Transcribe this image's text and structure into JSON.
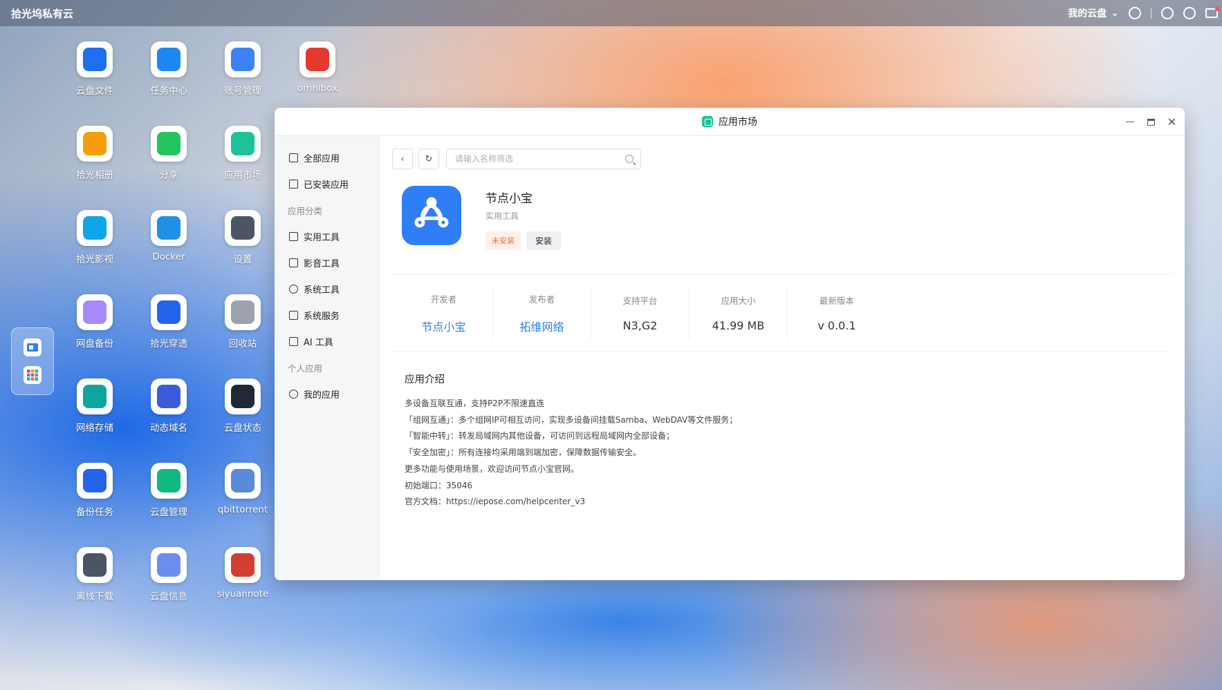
{
  "topbar": {
    "brand": "拾光坞私有云",
    "cloud_menu": "我的云盘"
  },
  "desktop": {
    "icons": [
      {
        "label": "云盘文件",
        "icon": "folder-icon",
        "color": "#1e6ff2"
      },
      {
        "label": "任务中心",
        "icon": "transfer-icon",
        "color": "#1e88f2"
      },
      {
        "label": "账号管理",
        "icon": "users-icon",
        "color": "#3b82f6"
      },
      {
        "label": "omnibox",
        "icon": "dolphin-icon",
        "color": "#e5392f"
      },
      {
        "label": "拾光相册",
        "icon": "flower-icon",
        "color": "#f59e0b"
      },
      {
        "label": "分享",
        "icon": "paper-plane-icon",
        "color": "#22c55e"
      },
      {
        "label": "应用市场",
        "icon": "shopping-bag-icon",
        "color": "#1dc29b"
      },
      {
        "label": "拾光影视",
        "icon": "play-icon",
        "color": "#0ea5e9"
      },
      {
        "label": "Docker",
        "icon": "docker-icon",
        "color": "#1d91e6"
      },
      {
        "label": "设置",
        "icon": "gear-icon",
        "color": "#4b5563"
      },
      {
        "label": "网盘备份",
        "icon": "cloud-backup-icon",
        "color": "#a78bfa"
      },
      {
        "label": "拾光穿透",
        "icon": "layers-icon",
        "color": "#2563eb"
      },
      {
        "label": "回收站",
        "icon": "recycle-bin-icon",
        "color": "#9ca3af"
      },
      {
        "label": "网络存储",
        "icon": "globe-storage-icon",
        "color": "#0ea5a0"
      },
      {
        "label": "动态域名",
        "icon": "ddns-icon",
        "color": "#3b5bdb"
      },
      {
        "label": "云盘状态",
        "icon": "monitor-chart-icon",
        "color": "#1f2937"
      },
      {
        "label": "备份任务",
        "icon": "backup-task-icon",
        "color": "#2563eb"
      },
      {
        "label": "云盘管理",
        "icon": "cloud-drive-icon",
        "color": "#10b981"
      },
      {
        "label": "qbittorrent",
        "icon": "qb-icon",
        "color": "#5b8ad6"
      },
      {
        "label": "离线下载",
        "icon": "download-icon",
        "color": "#4b5563"
      },
      {
        "label": "云盘信息",
        "icon": "bar-chart-icon",
        "color": "#6d8cf0"
      },
      {
        "label": "siyuannote",
        "icon": "siyuan-icon",
        "color": "#d23f31"
      }
    ]
  },
  "window": {
    "title": "应用市场",
    "sidebar": {
      "all_apps": "全部应用",
      "installed_apps": "已安装应用",
      "category_heading": "应用分类",
      "cat_utility": "实用工具",
      "cat_media": "影音工具",
      "cat_system": "系统工具",
      "cat_service": "系统服务",
      "cat_ai": "AI 工具",
      "personal_heading": "个人应用",
      "my_apps": "我的应用"
    },
    "search": {
      "placeholder": "请输入名称筛选"
    },
    "app": {
      "name": "节点小宝",
      "category": "实用工具",
      "status": "未安装",
      "install_label": "安装",
      "meta": {
        "developer_label": "开发者",
        "developer": "节点小宝",
        "publisher_label": "发布者",
        "publisher": "拓维网络",
        "platform_label": "支持平台",
        "platform": "N3,G2",
        "size_label": "应用大小",
        "size": "41.99 MB",
        "version_label": "最新版本",
        "version": "v 0.0.1"
      },
      "intro_title": "应用介绍",
      "intro_lines": [
        "多设备互联互通，支持P2P不限速直连",
        "「组网互通」：多个组网IP可相互访问，实现多设备间挂载Samba、WebDAV等文件服务；",
        "「智能中转」：转发局域网内其他设备，可访问到远程局域网内全部设备；",
        "「安全加密」：所有连接均采用端到端加密，保障数据传输安全。",
        "更多功能与使用场景，欢迎访问节点小宝官网。",
        "初始端口：35046",
        "官方文档：https://iepose.com/helpcenter_v3"
      ]
    }
  }
}
